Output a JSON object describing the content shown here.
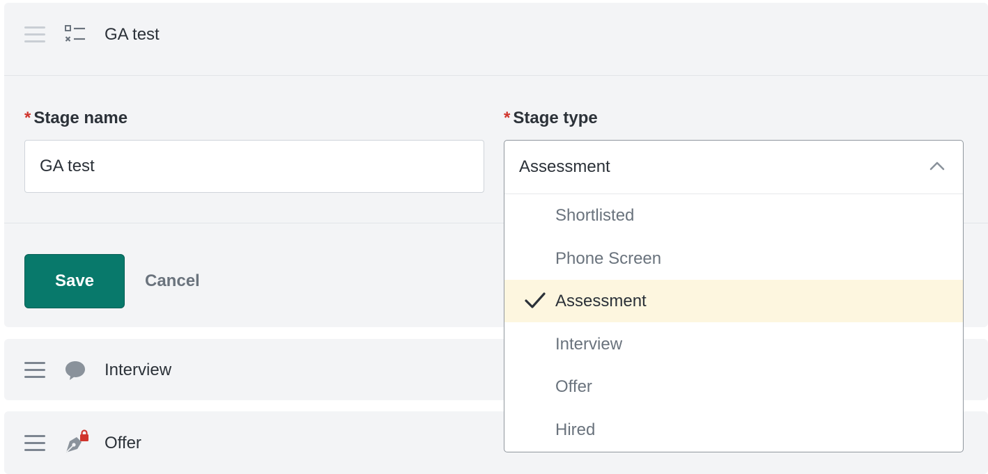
{
  "stage_edit": {
    "title": "GA test",
    "icon": "checklist-icon",
    "fields": {
      "stage_name": {
        "required_mark": "*",
        "label": "Stage name",
        "value": "GA test"
      },
      "stage_type": {
        "required_mark": "*",
        "label": "Stage type",
        "value": "Assessment",
        "expanded": true,
        "options": [
          "Shortlisted",
          "Phone Screen",
          "Assessment",
          "Interview",
          "Offer",
          "Hired"
        ],
        "selected_index": 2
      }
    },
    "actions": {
      "save_label": "Save",
      "cancel_label": "Cancel"
    }
  },
  "stages": [
    {
      "title": "Interview",
      "icon": "speech-bubble-icon"
    },
    {
      "title": "Offer",
      "icon": "pen-nib-locked-icon"
    }
  ],
  "colors": {
    "primary": "#08796b",
    "card_background": "#f3f4f6",
    "required": "#d0342c",
    "selected_option_background": "#fdf6df",
    "lock_badge": "#d0342c"
  }
}
